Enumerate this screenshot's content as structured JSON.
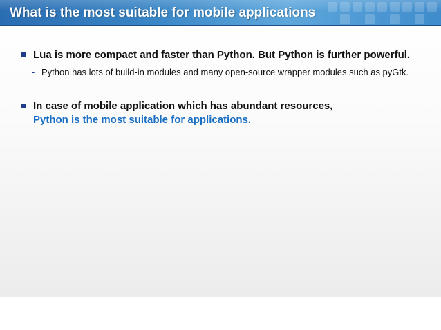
{
  "slide": {
    "title": "What is the most suitable for mobile applications",
    "bullets": [
      {
        "text": "Lua is more compact and faster than Python. But Python is further powerful.",
        "sub": "Python has lots of build-in modules and many open-source wrapper modules such as pyGtk."
      },
      {
        "text": "In case of mobile application which has abundant resources,",
        "highlight": "Python is the most suitable for applications."
      }
    ],
    "sub_marker": "-",
    "colors": {
      "title_bar": "#3a86c6",
      "bullet_marker": "#1d3f8a",
      "highlight": "#1a6fc4"
    }
  }
}
